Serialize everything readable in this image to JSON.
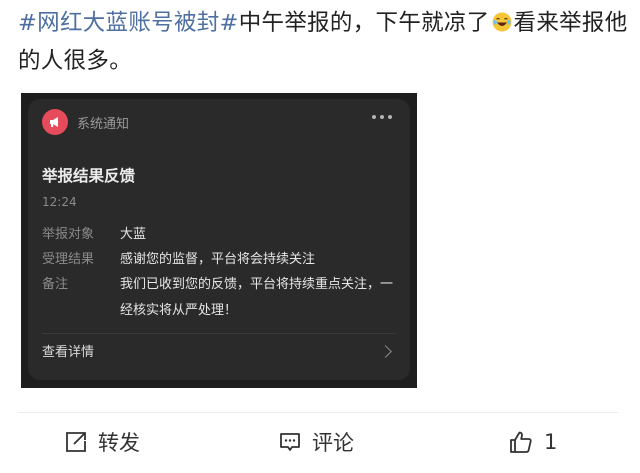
{
  "post": {
    "hashtag": "#网红大蓝账号被封#",
    "text_part1": "中午举报的，下午就凉了",
    "text_part2": "看来举报他的人很多。",
    "emoji": "laughing-crying-emoji"
  },
  "notification": {
    "sender": "系统通知",
    "title": "举报结果反馈",
    "time": "12:24",
    "rows": [
      {
        "label": "举报对象",
        "value": "大蓝"
      },
      {
        "label": "受理结果",
        "value": "感谢您的监督，平台将会持续关注"
      },
      {
        "label": "备注",
        "value": "我们已收到您的反馈，平台将持续重点关注，一经核实将从严处理！"
      }
    ],
    "details_link": "查看详情",
    "icon": "megaphone-icon",
    "accent_color": "#e54b5a"
  },
  "actions": {
    "repost_label": "转发",
    "comment_label": "评论",
    "like_count": "1"
  },
  "colors": {
    "hashtag": "#4e6fa1",
    "card_background": "#2a2a2b"
  }
}
